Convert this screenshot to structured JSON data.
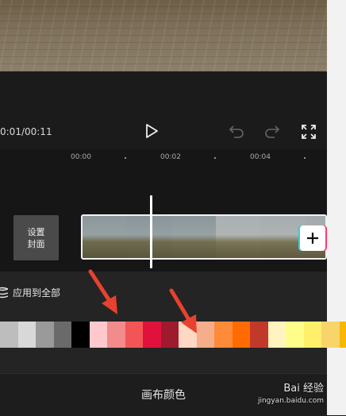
{
  "player": {
    "time_readout": "0:01/00:11"
  },
  "ruler": {
    "labels": [
      "00:00",
      "00:02",
      "00:04"
    ]
  },
  "timeline": {
    "cover_line1": "设置",
    "cover_line2": "封面",
    "add_clip_icon": "plus-icon"
  },
  "panel": {
    "apply_all_label": "应用到全部",
    "apply_all_icon": "layers-icon",
    "swatches": [
      "#bdbdbd",
      "#d8d8d8",
      "#9a9a9a",
      "#6a6a6a",
      "#000000",
      "#ffc8cc",
      "#f28b8b",
      "#f25555",
      "#e0123c",
      "#9e1a2e",
      "#ffd8c4",
      "#f6ad8a",
      "#ff8a3a",
      "#ff6b00",
      "#c0392b",
      "#fff4c0",
      "#fffd8a",
      "#fff06a",
      "#f8d46a",
      "#f6b800"
    ]
  },
  "footer": {
    "title": "画布颜色"
  },
  "watermark": {
    "text": "Bai 经验",
    "sub": "jingyan.baidu.com"
  },
  "colors": {
    "background": "#1b1b1b",
    "panel": "#242424",
    "annotation_arrow": "#e8412f"
  }
}
